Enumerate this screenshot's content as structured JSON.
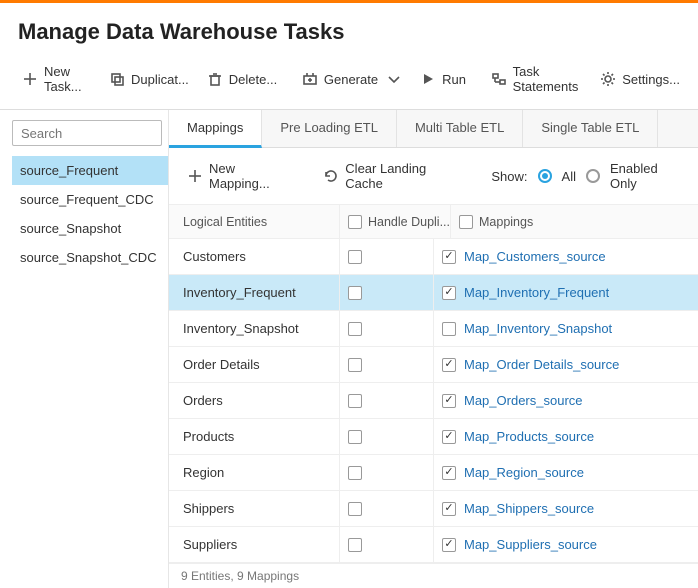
{
  "page_title": "Manage Data Warehouse Tasks",
  "toolbar": {
    "new_task": "New Task...",
    "duplicate": "Duplicat...",
    "delete": "Delete...",
    "generate": "Generate",
    "run": "Run",
    "task_stmt": "Task Statements",
    "settings": "Settings..."
  },
  "search_placeholder": "Search",
  "sources": [
    {
      "label": "source_Frequent",
      "selected": true
    },
    {
      "label": "source_Frequent_CDC",
      "selected": false
    },
    {
      "label": "source_Snapshot",
      "selected": false
    },
    {
      "label": "source_Snapshot_CDC",
      "selected": false
    }
  ],
  "tabs": [
    {
      "label": "Mappings",
      "active": true
    },
    {
      "label": "Pre Loading ETL",
      "active": false
    },
    {
      "label": "Multi Table ETL",
      "active": false
    },
    {
      "label": "Single Table ETL",
      "active": false
    }
  ],
  "subbar": {
    "new_mapping": "New Mapping...",
    "clear_cache": "Clear Landing Cache",
    "show_label": "Show:",
    "opt_all": "All",
    "opt_enabled": "Enabled Only",
    "selected": "all"
  },
  "grid": {
    "headers": {
      "entities": "Logical Entities",
      "dup": "Handle Dupli...",
      "mappings": "Mappings"
    },
    "rows": [
      {
        "entity": "Customers",
        "dup": false,
        "map_checked": true,
        "mapping": "Map_Customers_source",
        "highlight": false
      },
      {
        "entity": "Inventory_Frequent",
        "dup": false,
        "map_checked": true,
        "mapping": "Map_Inventory_Frequent",
        "highlight": true
      },
      {
        "entity": "Inventory_Snapshot",
        "dup": false,
        "map_checked": false,
        "mapping": "Map_Inventory_Snapshot",
        "highlight": false
      },
      {
        "entity": "Order Details",
        "dup": false,
        "map_checked": true,
        "mapping": "Map_Order Details_source",
        "highlight": false
      },
      {
        "entity": "Orders",
        "dup": false,
        "map_checked": true,
        "mapping": "Map_Orders_source",
        "highlight": false
      },
      {
        "entity": "Products",
        "dup": false,
        "map_checked": true,
        "mapping": "Map_Products_source",
        "highlight": false
      },
      {
        "entity": "Region",
        "dup": false,
        "map_checked": true,
        "mapping": "Map_Region_source",
        "highlight": false
      },
      {
        "entity": "Shippers",
        "dup": false,
        "map_checked": true,
        "mapping": "Map_Shippers_source",
        "highlight": false
      },
      {
        "entity": "Suppliers",
        "dup": false,
        "map_checked": true,
        "mapping": "Map_Suppliers_source",
        "highlight": false
      }
    ],
    "footer": "9 Entities, 9 Mappings"
  }
}
